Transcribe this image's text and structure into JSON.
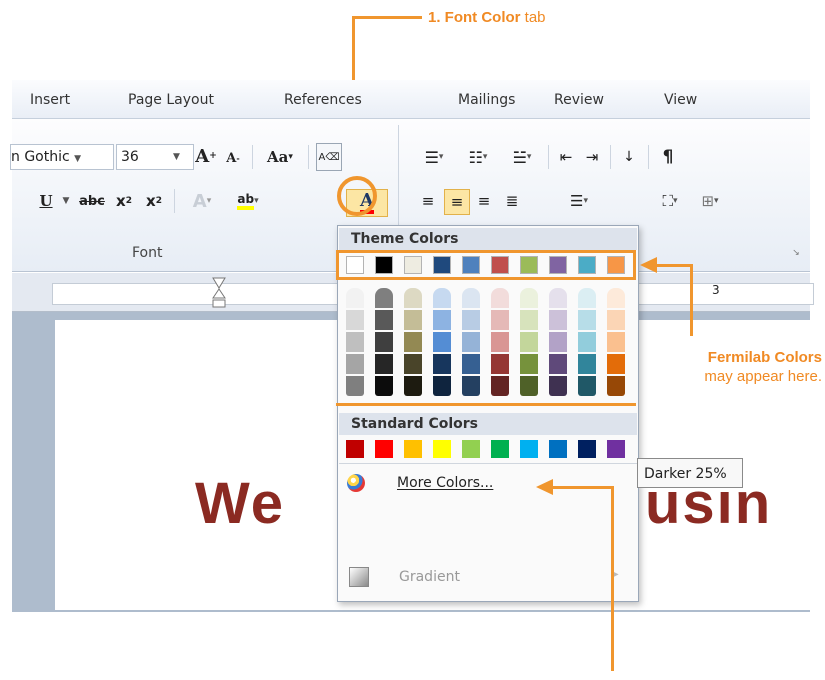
{
  "annotations": {
    "font_color_tab": {
      "bold": "1. Font Color",
      "rest": " tab"
    },
    "fermilab": {
      "bold": "Fermilab Colors",
      "rest": "may appear here."
    }
  },
  "ribbon_tabs": [
    "Insert",
    "Page Layout",
    "References",
    "Mailings",
    "Review",
    "View"
  ],
  "font_group": {
    "font_name": "n Gothic",
    "font_size": "36",
    "label": "Font"
  },
  "document_text": {
    "left": "We",
    "right": "usin"
  },
  "menu": {
    "theme_header": "Theme Colors",
    "standard_header": "Standard Colors",
    "more_colors": "More Colors...",
    "gradient": "Gradient",
    "tooltip": "Darker 25%",
    "theme_colors": [
      "#ffffff",
      "#000000",
      "#eeece1",
      "#1f497d",
      "#4f81bd",
      "#c0504d",
      "#9bbb59",
      "#8064a2",
      "#4bacc6",
      "#f79646"
    ],
    "theme_shades": [
      [
        "#f2f2f2",
        "#d8d8d8",
        "#bfbfbf",
        "#a5a5a5",
        "#7f7f7f"
      ],
      [
        "#7f7f7f",
        "#595959",
        "#3f3f3f",
        "#262626",
        "#0c0c0c"
      ],
      [
        "#ddd9c3",
        "#c4bd97",
        "#938953",
        "#494429",
        "#1d1b10"
      ],
      [
        "#c6d9f0",
        "#8db3e2",
        "#548dd4",
        "#17365d",
        "#0f243e"
      ],
      [
        "#dbe5f1",
        "#b8cce4",
        "#95b3d7",
        "#366092",
        "#244061"
      ],
      [
        "#f2dcdb",
        "#e5b9b7",
        "#d99694",
        "#953734",
        "#632423"
      ],
      [
        "#ebf1dd",
        "#d7e3bc",
        "#c3d69b",
        "#76923c",
        "#4f6128"
      ],
      [
        "#e5e0ec",
        "#ccc1d9",
        "#b2a2c7",
        "#5f497a",
        "#3f3151"
      ],
      [
        "#dbeef3",
        "#b7dde8",
        "#92cddc",
        "#31859b",
        "#205867"
      ],
      [
        "#fdeada",
        "#fbd5b5",
        "#fac08f",
        "#e36c09",
        "#974806"
      ]
    ],
    "standard_colors": [
      "#c00000",
      "#ff0000",
      "#ffc000",
      "#ffff00",
      "#92d050",
      "#00b050",
      "#00b0f0",
      "#0070c0",
      "#002060",
      "#7030a0"
    ]
  },
  "ruler_mark": "3"
}
